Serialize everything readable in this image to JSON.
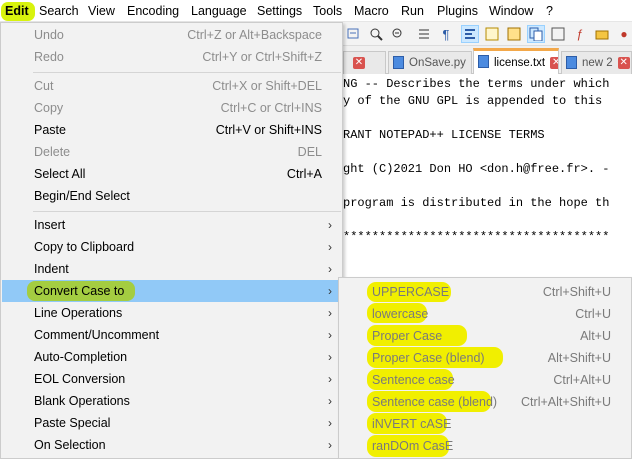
{
  "menubar": {
    "items": [
      "Edit",
      "Search",
      "View",
      "Encoding",
      "Language",
      "Settings",
      "Tools",
      "Macro",
      "Run",
      "Plugins",
      "Window",
      "?"
    ]
  },
  "tabs": [
    {
      "label": "OnSave.py",
      "active": false
    },
    {
      "label": "license.txt",
      "active": true
    },
    {
      "label": "new 2",
      "active": false
    }
  ],
  "editor": {
    "lines": [
      "NG -- Describes the terms under which",
      "y of the GNU GPL is appended to this",
      "",
      "RANT NOTEPAD++ LICENSE TERMS",
      "",
      "ght (C)2021 Don HO <don.h@free.fr>. -",
      "",
      "program is distributed in the hope th",
      "",
      "*************************************"
    ]
  },
  "edit_menu": {
    "undo": {
      "label": "Undo",
      "shortcut": "Ctrl+Z or Alt+Backspace"
    },
    "redo": {
      "label": "Redo",
      "shortcut": "Ctrl+Y or Ctrl+Shift+Z"
    },
    "cut": {
      "label": "Cut",
      "shortcut": "Ctrl+X or Shift+DEL"
    },
    "copy": {
      "label": "Copy",
      "shortcut": "Ctrl+C or Ctrl+INS"
    },
    "paste": {
      "label": "Paste",
      "shortcut": "Ctrl+V or Shift+INS"
    },
    "delete": {
      "label": "Delete",
      "shortcut": "DEL"
    },
    "select_all": {
      "label": "Select All",
      "shortcut": "Ctrl+A"
    },
    "begin_end_select": {
      "label": "Begin/End Select"
    },
    "insert": {
      "label": "Insert"
    },
    "copy_to_clipboard": {
      "label": "Copy to Clipboard"
    },
    "indent": {
      "label": "Indent"
    },
    "convert_case": {
      "label": "Convert Case to"
    },
    "line_operations": {
      "label": "Line Operations"
    },
    "comment": {
      "label": "Comment/Uncomment"
    },
    "auto_completion": {
      "label": "Auto-Completion"
    },
    "eol_conversion": {
      "label": "EOL Conversion"
    },
    "blank_operations": {
      "label": "Blank Operations"
    },
    "paste_special": {
      "label": "Paste Special"
    },
    "on_selection": {
      "label": "On Selection"
    }
  },
  "convert_submenu": [
    {
      "label": "UPPERCASE",
      "shortcut": "Ctrl+Shift+U"
    },
    {
      "label": "lowercase",
      "shortcut": "Ctrl+U"
    },
    {
      "label": "Proper Case",
      "shortcut": "Alt+U"
    },
    {
      "label": "Proper Case (blend)",
      "shortcut": "Alt+Shift+U"
    },
    {
      "label": "Sentence case",
      "shortcut": "Ctrl+Alt+U"
    },
    {
      "label": "Sentence case (blend)",
      "shortcut": "Ctrl+Alt+Shift+U"
    },
    {
      "label": "iNVERT cASE",
      "shortcut": ""
    },
    {
      "label": "ranDOm CasE",
      "shortcut": ""
    }
  ],
  "colors": {
    "highlight_yellow": "#f1ef00",
    "highlight_green": "#a6cd2c",
    "menu_selected": "#91c9f7",
    "tab_accent": "#f3a84a"
  }
}
